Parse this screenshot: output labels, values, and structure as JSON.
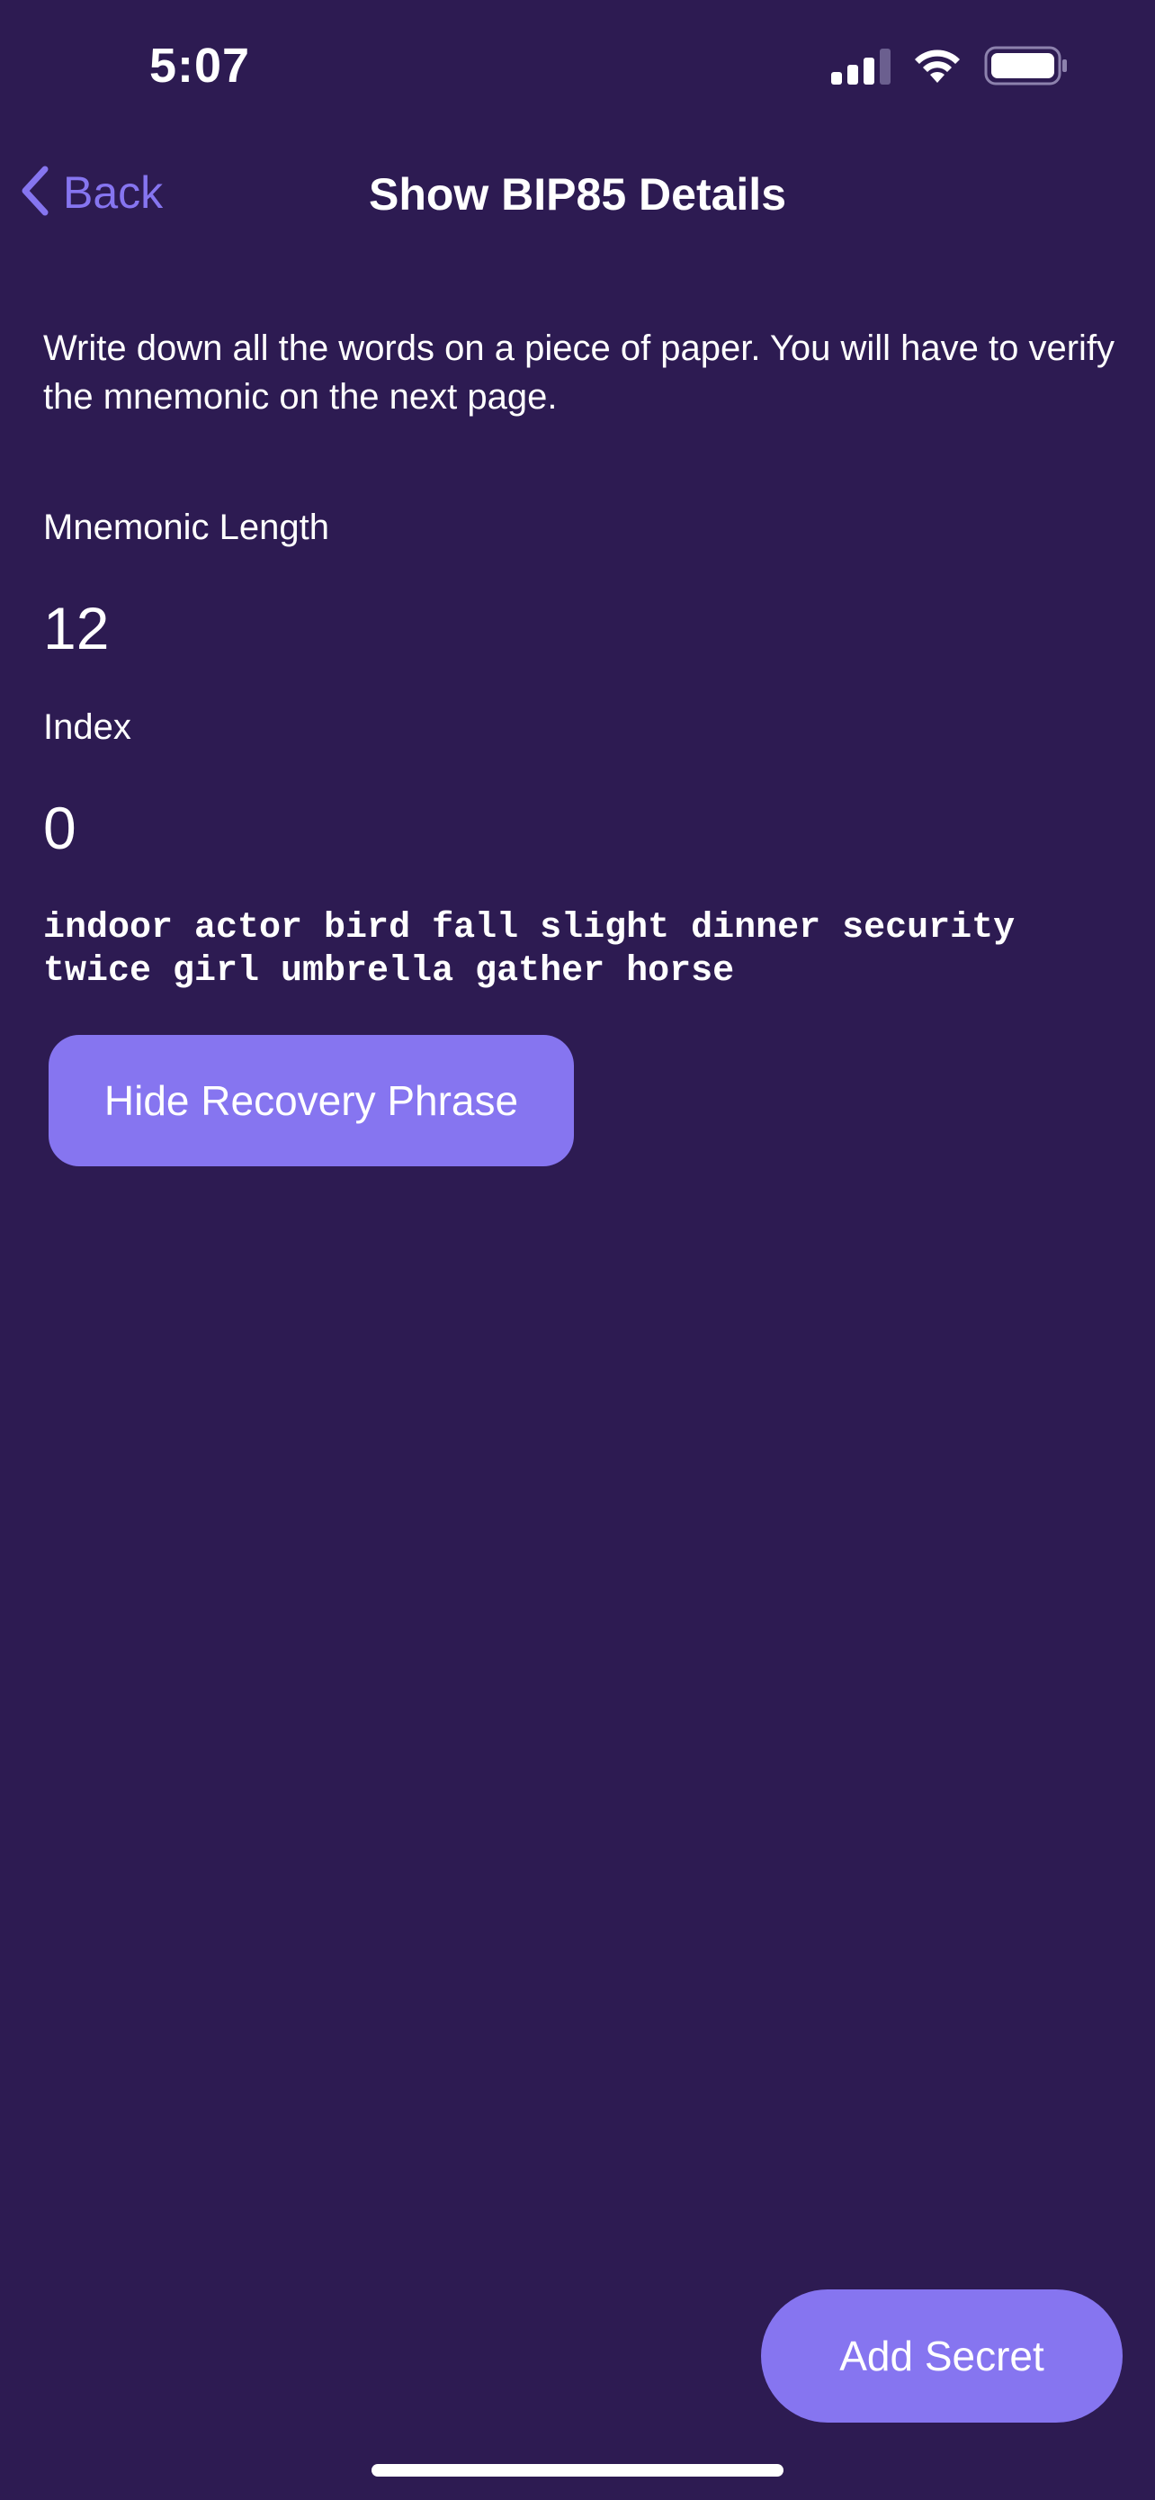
{
  "status_bar": {
    "time": "5:07"
  },
  "nav": {
    "back_label": "Back",
    "title": "Show BIP85 Details"
  },
  "main": {
    "instructions": "Write down all the words on a piece of paper. You will have to verify the mnemonic on the next page.",
    "mnemonic_length_label": "Mnemonic Length",
    "mnemonic_length_value": "12",
    "index_label": "Index",
    "index_value": "0",
    "mnemonic_words": "indoor actor bird fall slight dinner security\ntwice girl umbrella gather horse",
    "hide_button_label": "Hide Recovery Phrase"
  },
  "footer": {
    "add_secret_label": "Add Secret"
  },
  "colors": {
    "background": "#2d1b52",
    "accent": "#8675f0",
    "text": "#ffffff"
  },
  "icons": {
    "back": "chevron-left-icon",
    "signal": "cellular-signal-icon",
    "wifi": "wifi-icon",
    "battery": "battery-icon"
  }
}
